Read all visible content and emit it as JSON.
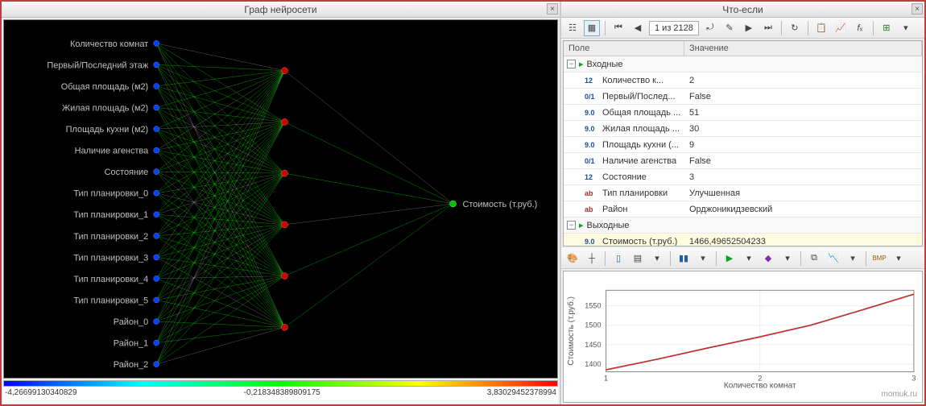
{
  "left": {
    "title": "Граф нейросети",
    "inputs": [
      "Количество комнат",
      "Первый/Последний этаж",
      "Общая площадь (м2)",
      "Жилая площадь (м2)",
      "Площадь кухни (м2)",
      "Наличие агенства",
      "Состояние",
      "Тип планировки_0",
      "Тип планировки_1",
      "Тип планировки_2",
      "Тип планировки_3",
      "Тип планировки_4",
      "Тип планировки_5",
      "Район_0",
      "Район_1",
      "Район_2"
    ],
    "output_label": "Стоимость (т.руб.)",
    "hidden_count": 6,
    "scale": {
      "min": "-4,26699130340829",
      "mid": "-0,218348389809175",
      "max": "3,83029452378994"
    }
  },
  "right": {
    "title": "Что-если",
    "paginator": "1 из 2128",
    "headers": {
      "field": "Поле",
      "value": "Значение"
    },
    "group_in": "Входные",
    "group_out": "Выходные",
    "rows_in": [
      {
        "type": "12",
        "label": "Количество к...",
        "value": "2"
      },
      {
        "type": "0/1",
        "label": "Первый/Послед...",
        "value": "False"
      },
      {
        "type": "9.0",
        "label": "Общая площадь ...",
        "value": "51"
      },
      {
        "type": "9.0",
        "label": "Жилая площадь ...",
        "value": "30"
      },
      {
        "type": "9.0",
        "label": "Площадь кухни (...",
        "value": "9"
      },
      {
        "type": "0/1",
        "label": "Наличие агенства",
        "value": "False"
      },
      {
        "type": "12",
        "label": "Состояние",
        "value": "3"
      },
      {
        "type": "ab",
        "label": "Тип планировки",
        "value": "Улучшенная"
      },
      {
        "type": "ab",
        "label": "Район",
        "value": "Орджоникидзевский"
      }
    ],
    "rows_out": [
      {
        "type": "9.0",
        "label": "Стоимость (т.руб.)",
        "value": "1466,49652504233"
      }
    ],
    "chart_data": {
      "type": "line",
      "xlabel": "Количество комнат",
      "ylabel": "Стоимость (т.руб.)",
      "x": [
        1,
        1.33,
        1.67,
        2,
        2.33,
        2.67,
        3
      ],
      "y": [
        1385,
        1412,
        1442,
        1470,
        1500,
        1540,
        1580
      ],
      "ylim": [
        1380,
        1590
      ],
      "xlim": [
        1,
        3
      ],
      "yticks": [
        1400,
        1450,
        1500,
        1550
      ],
      "xticks": [
        1,
        2,
        3
      ]
    },
    "watermark": "momuk.ru"
  }
}
